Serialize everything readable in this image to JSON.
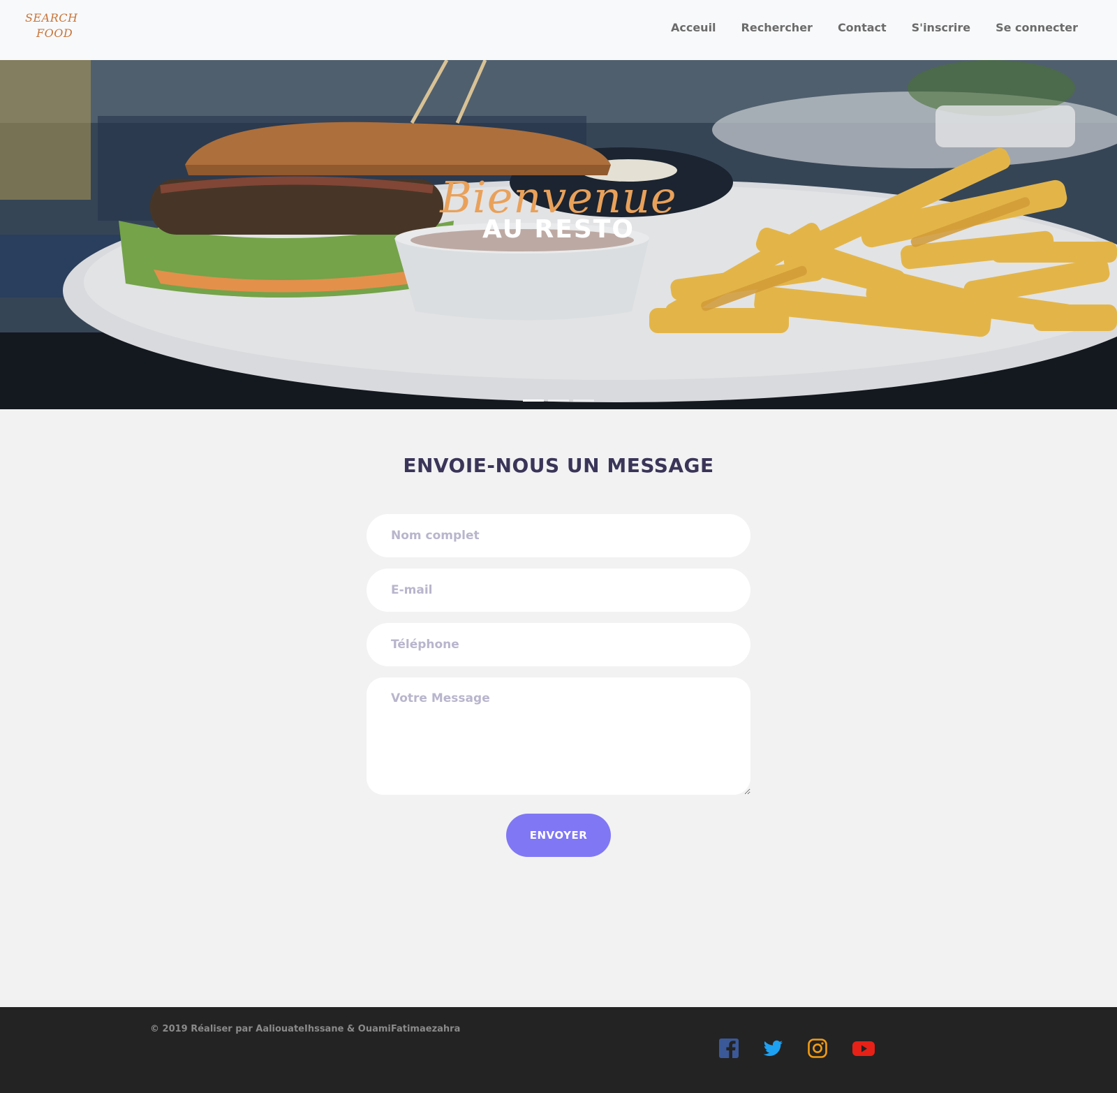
{
  "brand": {
    "line1": "SEARCH",
    "line2": "FOOD"
  },
  "nav": {
    "items": [
      "Acceuil",
      "Rechercher",
      "Contact",
      "S'inscrire",
      "Se connecter"
    ]
  },
  "hero": {
    "script_title": "Bienvenue",
    "title": "AU RESTO",
    "slides_total": 3,
    "active_slide": 1
  },
  "contact": {
    "heading": "ENVOIE-NOUS UN MESSAGE",
    "name_placeholder": "Nom complet",
    "email_placeholder": "E-mail",
    "phone_placeholder": "Téléphone",
    "message_placeholder": "Votre Message",
    "submit_label": "ENVOYER"
  },
  "footer": {
    "copyright": "© 2019 Réaliser par AaliouateIhssane & OuamiFatimaezahra",
    "social": [
      "facebook-icon",
      "twitter-icon",
      "instagram-icon",
      "youtube-icon"
    ]
  },
  "colors": {
    "accent": "#8077f5",
    "heading": "#3a3558",
    "script": "#e9a15a",
    "footer_bg": "#232323",
    "facebook": "#3b5998",
    "twitter": "#1da1f2",
    "instagram": "#f39c12",
    "youtube": "#e62117"
  }
}
